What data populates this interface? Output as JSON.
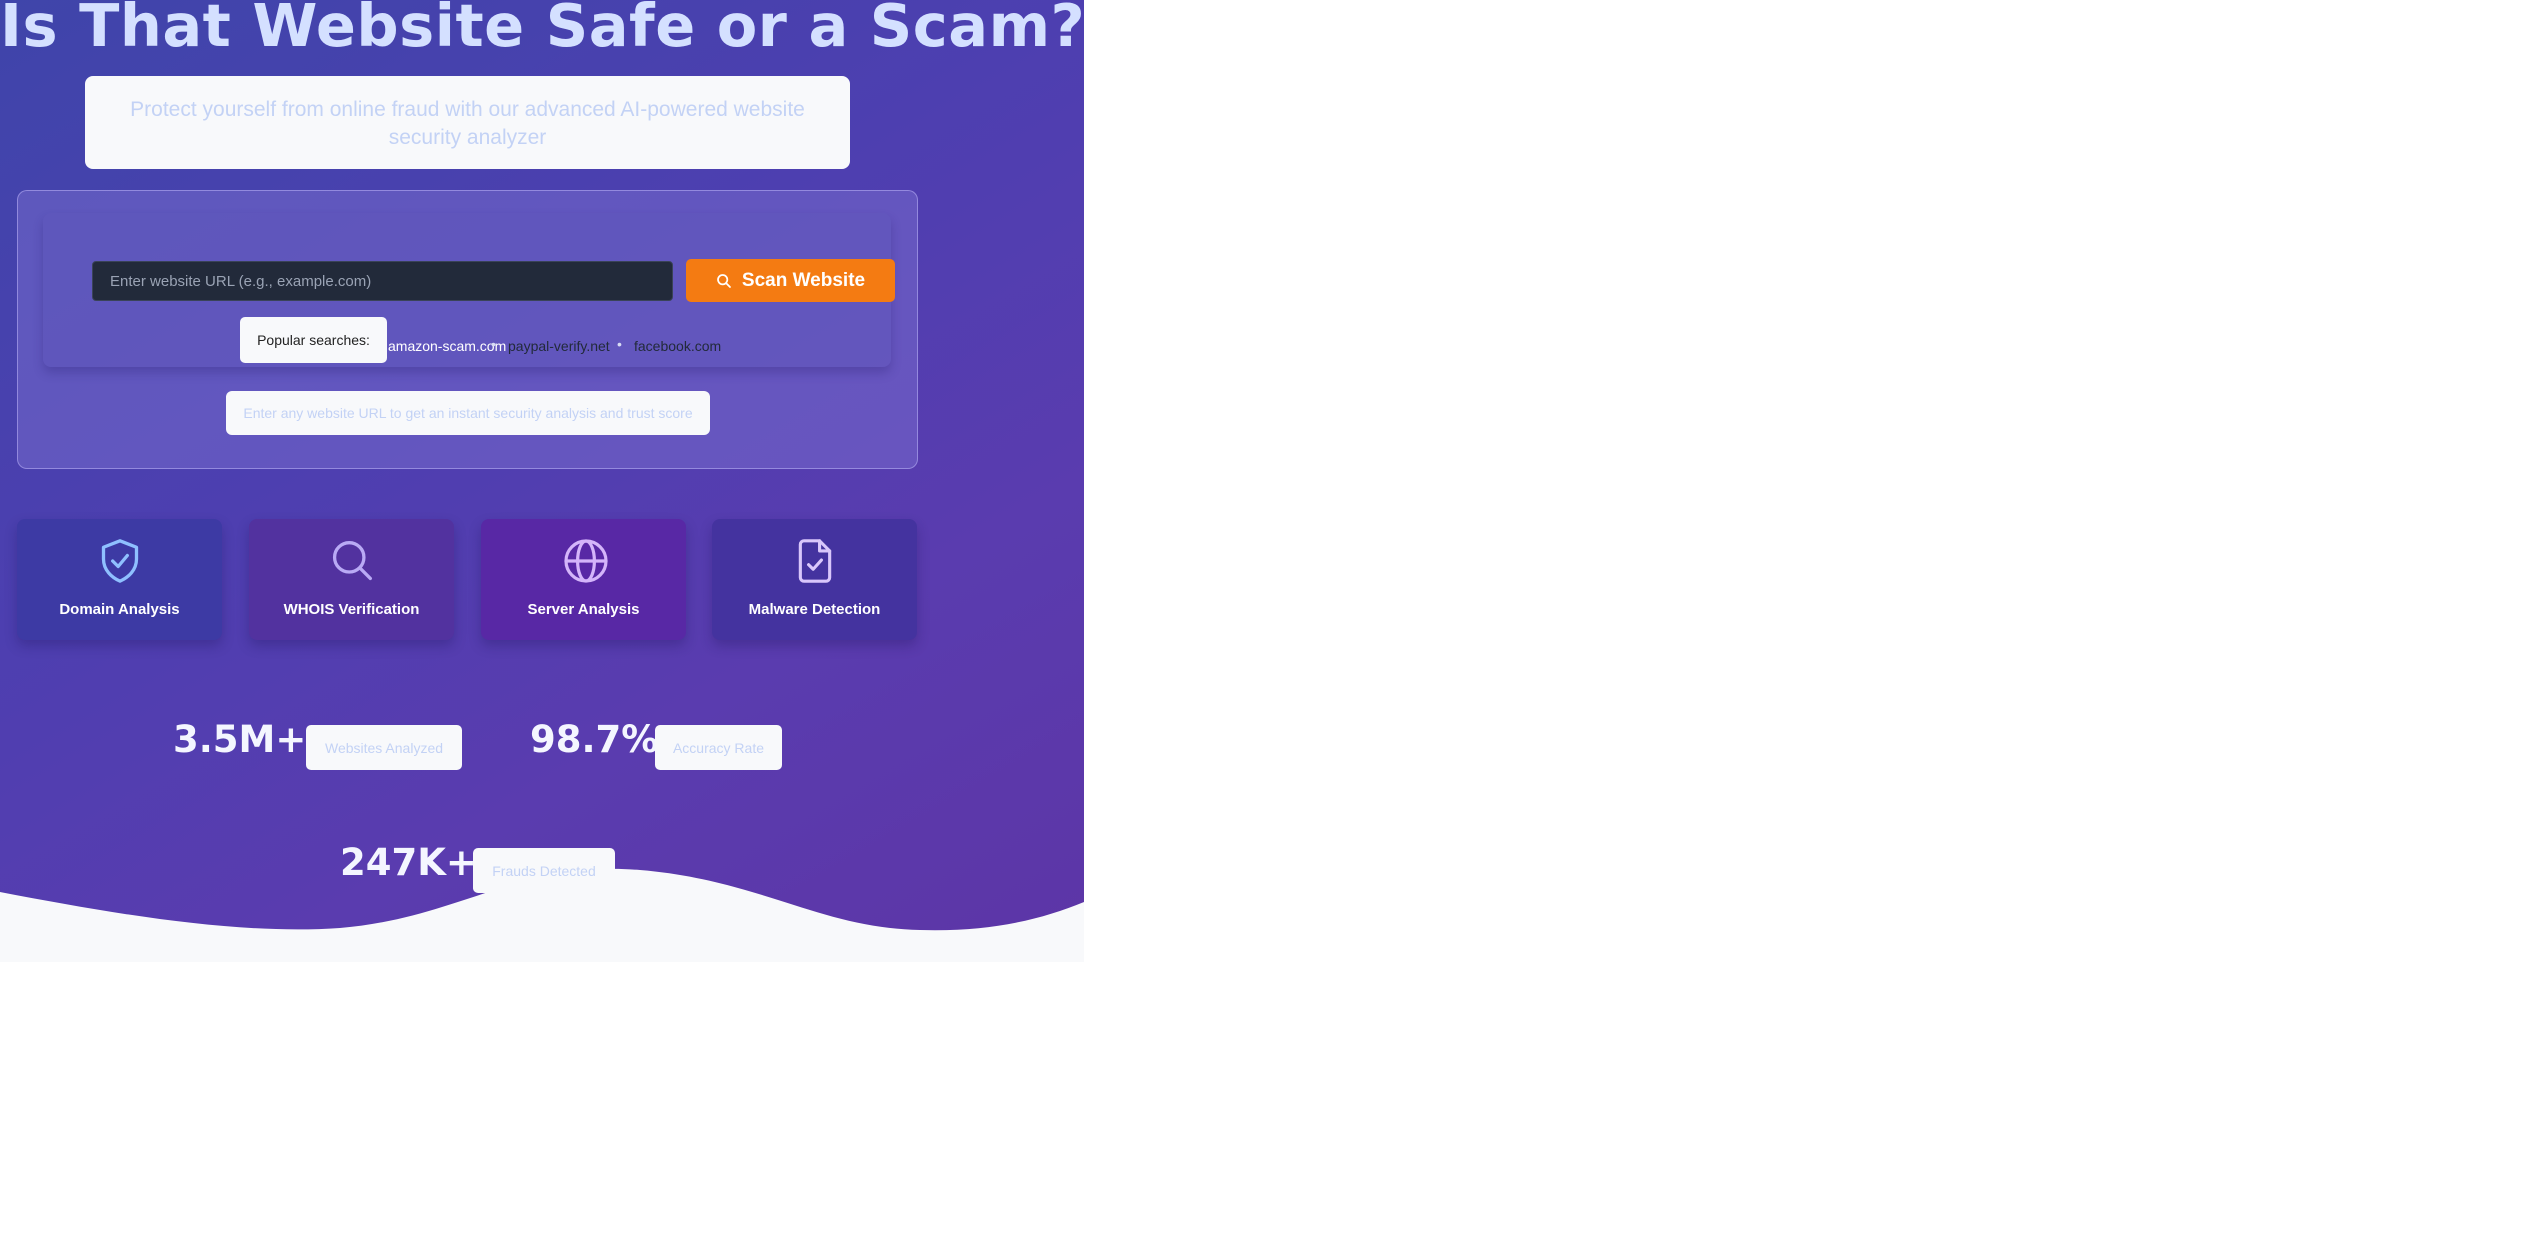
{
  "hero": {
    "title": "Is That Website Safe or a Scam?",
    "subtitle": "Protect yourself from online fraud with our advanced AI-powered website security analyzer"
  },
  "scan": {
    "input_placeholder": "Enter website URL (e.g., example.com)",
    "button_label": "Scan Website",
    "popular_label": "Popular searches:",
    "popular_links": [
      "amazon-scam.com",
      "paypal-verify.net",
      "facebook.com"
    ],
    "separator": "•",
    "hint": "Enter any website URL to get an instant security analysis and trust score"
  },
  "features": [
    {
      "label": "Domain Analysis",
      "icon": "shield-check-icon"
    },
    {
      "label": "WHOIS Verification",
      "icon": "search-icon"
    },
    {
      "label": "Server Analysis",
      "icon": "globe-icon"
    },
    {
      "label": "Malware Detection",
      "icon": "file-check-icon"
    }
  ],
  "stats": [
    {
      "value": "3.5M+",
      "label": "Websites Analyzed"
    },
    {
      "value": "98.7%",
      "label": "Accuracy Rate"
    },
    {
      "value": "247K+",
      "label": "Frauds Detected"
    }
  ],
  "colors": {
    "hero_gradient_start": "#3f45aa",
    "hero_gradient_end": "#5d35a6",
    "scan_button": "#f47b12",
    "input_background": "#222a3a",
    "title": "#d4e0ff",
    "muted_text": "#c3d2f5"
  }
}
